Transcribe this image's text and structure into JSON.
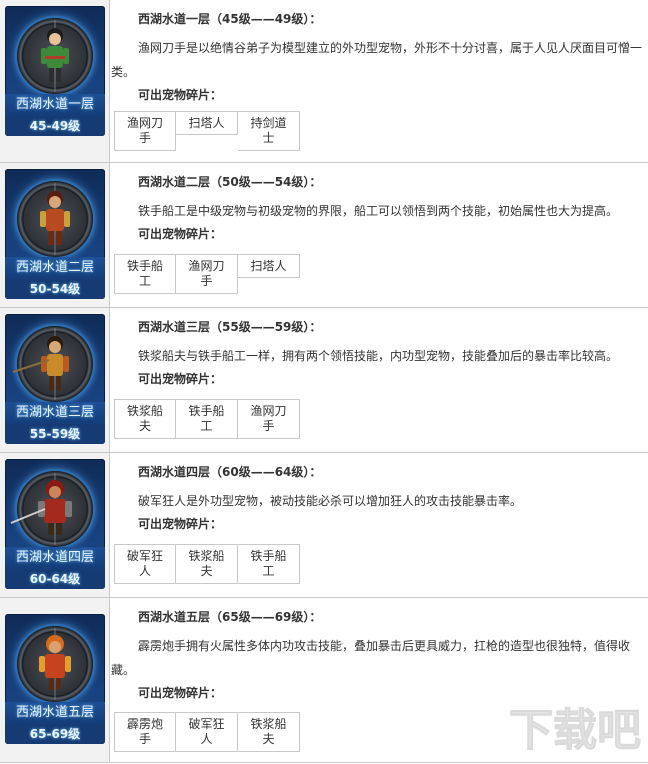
{
  "rows": [
    {
      "card_name": "西湖水道一层",
      "card_level": "45-49级",
      "title": "西湖水道一层（45级——49级）：",
      "desc": "渔网刀手是以绝情谷弟子为模型建立的外功型宠物，外形不十分讨喜，属于人见人厌面目可憎一类。",
      "frag_label": "可出宠物碎片：",
      "frags": [
        "渔网刀手",
        "扫塔人",
        "持剑道士"
      ]
    },
    {
      "card_name": "西湖水道二层",
      "card_level": "50-54级",
      "title": "西湖水道二层（50级——54级）：",
      "desc": "铁手船工是中级宠物与初级宠物的界限，船工可以领悟到两个技能，初始属性也大为提高。",
      "frag_label": "可出宠物碎片：",
      "frags": [
        "铁手船工",
        "渔网刀手",
        "扫塔人"
      ]
    },
    {
      "card_name": "西湖水道三层",
      "card_level": "55-59级",
      "title": "西湖水道三层（55级——59级）：",
      "desc": "铁浆船夫与铁手船工一样，拥有两个领悟技能，内功型宠物，技能叠加后的暴击率比较高。",
      "frag_label": "可出宠物碎片：",
      "frags": [
        "铁浆船夫",
        "铁手船工",
        "渔网刀手"
      ]
    },
    {
      "card_name": "西湖水道四层",
      "card_level": "60-64级",
      "title": "西湖水道四层（60级——64级）：",
      "desc": "破军狂人是外功型宠物，被动技能必杀可以增加狂人的攻击技能暴击率。",
      "frag_label": "可出宠物碎片：",
      "frags": [
        "破军狂人",
        "铁浆船夫",
        "铁手船工"
      ]
    },
    {
      "card_name": "西湖水道五层",
      "card_level": "65-69级",
      "title": "西湖水道五层（65级——69级）：",
      "desc": "霹雳炮手拥有火属性多体内功攻击技能，叠加暴击后更具威力，扛枪的造型也很独特，值得收藏。",
      "frag_label": "可出宠物碎片：",
      "frags": [
        "霹雳炮手",
        "破军狂人",
        "铁浆船夫"
      ]
    }
  ],
  "watermark": "下载吧",
  "colors": {
    "border": "#c9c9c9",
    "card_bg": "#17407c",
    "card_glow": "#60b0ff",
    "text": "#333333"
  }
}
